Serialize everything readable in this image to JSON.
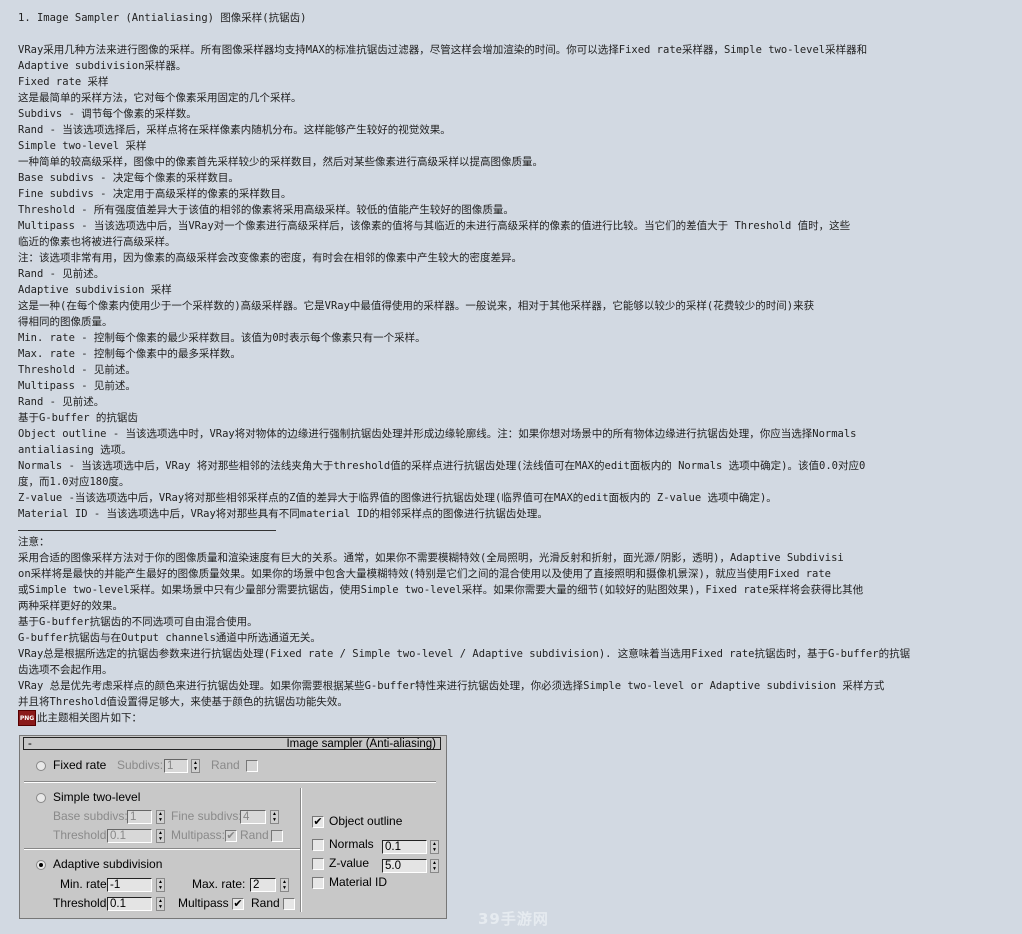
{
  "document": {
    "title": "1. Image Sampler (Antialiasing) 图像采样(抗锯齿)",
    "lines": [
      "VRay采用几种方法来进行图像的采样。所有图像采样器均支持MAX的标准抗锯齿过滤器，尽管这样会增加渲染的时间。你可以选择Fixed rate采样器，Simple two-level采样器和",
      "Adaptive subdivision采样器。",
      "Fixed rate 采样",
      "这是最简单的采样方法，它对每个像素采用固定的几个采样。",
      "Subdivs - 调节每个像素的采样数。",
      "Rand - 当该选项选择后，采样点将在采样像素内随机分布。这样能够产生较好的视觉效果。",
      "Simple two-level 采样",
      "一种简单的较高级采样，图像中的像素首先采样较少的采样数目，然后对某些像素进行高级采样以提高图像质量。",
      "Base subdivs - 决定每个像素的采样数目。",
      "Fine subdivs - 决定用于高级采样的像素的采样数目。",
      "Threshold - 所有强度值差异大于该值的相邻的像素将采用高级采样。较低的值能产生较好的图像质量。",
      "Multipass - 当该选项选中后，当VRay对一个像素进行高级采样后，该像素的值将与其临近的未进行高级采样的像素的值进行比较。当它们的差值大于 Threshold 值时，这些",
      "临近的像素也将被进行高级采样。",
      "注：该选项非常有用，因为像素的高级采样会改变像素的密度，有时会在相邻的像素中产生较大的密度差异。",
      "Rand - 见前述。",
      "Adaptive subdivision 采样",
      "这是一种(在每个像素内使用少于一个采样数的)高级采样器。它是VRay中最值得使用的采样器。一般说来，相对于其他采样器，它能够以较少的采样(花费较少的时间)来获",
      "得相同的图像质量。",
      "Min. rate - 控制每个像素的最少采样数目。该值为0时表示每个像素只有一个采样。",
      "Max. rate - 控制每个像素中的最多采样数。",
      "Threshold - 见前述。",
      "Multipass - 见前述。",
      "Rand - 见前述。",
      "基于G-buffer 的抗锯齿",
      "Object outline - 当该选项选中时，VRay将对物体的边缘进行强制抗锯齿处理并形成边缘轮廓线。注：如果你想对场景中的所有物体边缘进行抗锯齿处理，你应当选择Normals",
      "antialiasing 选项。",
      "Normals - 当该选项选中后，VRay 将对那些相邻的法线夹角大于threshold值的采样点进行抗锯齿处理(法线值可在MAX的edit面板内的 Normals 选项中确定)。该值0.0对应0",
      "度，而1.0对应180度。",
      "Z-value -当该选项选中后，VRay将对那些相邻采样点的Z值的差异大于临界值的图像进行抗锯齿处理(临界值可在MAX的edit面板内的 Z-value 选项中确定)。",
      "Material ID - 当该选项选中后，VRay将对那些具有不同material ID的相邻采样点的图像进行抗锯齿处理。"
    ],
    "notes_lines": [
      "注意：",
      "采用合适的图像采样方法对于你的图像质量和渲染速度有巨大的关系。通常，如果你不需要模糊特效(全局照明，光滑反射和折射，面光源/阴影，透明)，Adaptive Subdivisi",
      "on采样将是最快的并能产生最好的图像质量效果。如果你的场景中包含大量模糊特效(特别是它们之间的混合使用以及使用了直接照明和摄像机景深)，就应当使用Fixed rate",
      "或Simple two-level采样。如果场景中只有少量部分需要抗锯齿，使用Simple two-level采样。如果你需要大量的细节(如较好的贴图效果)，Fixed rate采样将会获得比其他",
      "两种采样更好的效果。",
      "基于G-buffer抗锯齿的不同选项可自由混合使用。",
      "G-buffer抗锯齿与在Output channels通道中所选通道无关。",
      "VRay总是根据所选定的抗锯齿参数来进行抗锯齿处理(Fixed rate / Simple two-level / Adaptive subdivision). 这意味着当选用Fixed rate抗锯齿时，基于G-buffer的抗锯",
      "齿选项不会起作用。",
      "VRay 总是优先考虑采样点的颜色来进行抗锯齿处理。如果你需要根据某些G-buffer特性来进行抗锯齿处理，你必须选择Simple two-level or Adaptive subdivision 采样方式",
      "并且将Threshold值设置得足够大，来使基于颜色的抗锯齿功能失效。"
    ],
    "attachment_icon": "PNG",
    "attachment_label": "此主题相关图片如下："
  },
  "panel": {
    "collapse": "-",
    "title": "Image sampler (Anti-aliasing)",
    "fixed_rate": {
      "label": "Fixed rate",
      "selected": false,
      "subdivs_label": "Subdivs:",
      "subdivs": "1",
      "rand_label": "Rand",
      "rand": false
    },
    "simple_two_level": {
      "label": "Simple two-level",
      "selected": false,
      "base_subdivs_label": "Base subdivs:",
      "base_subdivs": "1",
      "fine_subdivs_label": "Fine subdivs:",
      "fine_subdivs": "4",
      "threshold_label": "Threshold:",
      "threshold": "0.1",
      "multipass_label": "Multipass:",
      "multipass": true,
      "rand_label": "Rand",
      "rand": false
    },
    "adaptive": {
      "label": "Adaptive subdivision",
      "selected": true,
      "min_rate_label": "Min. rate:",
      "min_rate": "-1",
      "max_rate_label": "Max. rate:",
      "max_rate": "2",
      "threshold_label": "Threshold:",
      "threshold": "0.1",
      "multipass_label": "Multipass",
      "multipass": true,
      "rand_label": "Rand",
      "rand": false
    },
    "gbuffer": {
      "object_outline_label": "Object outline",
      "object_outline": true,
      "normals_label": "Normals",
      "normals": false,
      "normals_value": "0.1",
      "zvalue_label": "Z-value",
      "zvalue": false,
      "zvalue_value": "5.0",
      "material_id_label": "Material ID",
      "material_id": false
    }
  },
  "watermark": "39手游网",
  "icons": {
    "spinner": "▲▼",
    "check": "✔"
  }
}
